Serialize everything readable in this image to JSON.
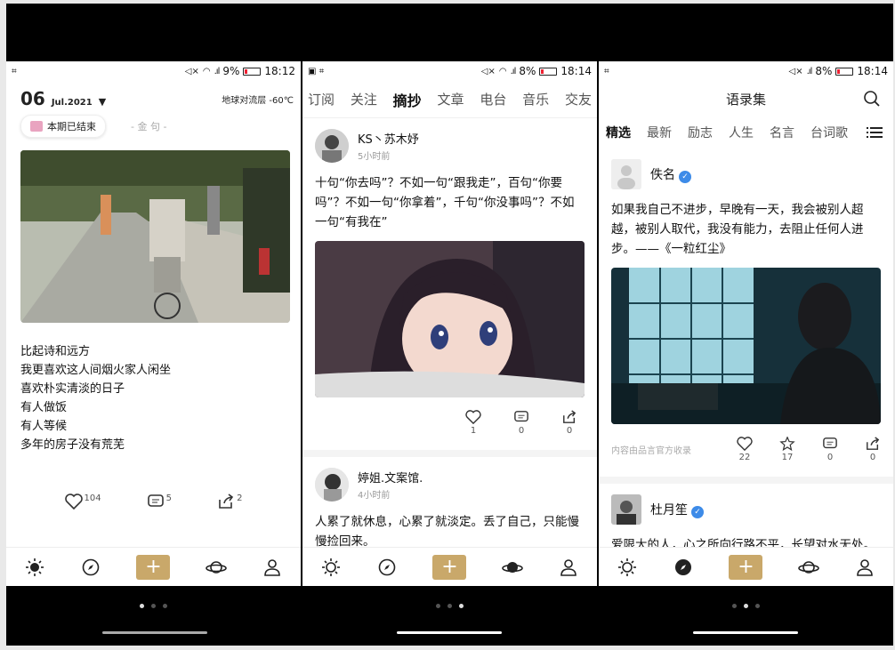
{
  "screens": {
    "p1": {
      "status": {
        "left": "🕗",
        "batt": "9%",
        "time": "18:12"
      },
      "date": {
        "day": "06",
        "month": "Jul.2021"
      },
      "weather": "地球对流层 -60℃",
      "tag": "本期已结束",
      "category": "- 金 句 -",
      "poem": [
        "比起诗和远方",
        "我更喜欢这人间烟火家人闲坐",
        "喜欢朴实清淡的日子",
        "有人做饭",
        "有人等候",
        "多年的房子没有荒芜"
      ],
      "likes": "104",
      "comments": "5",
      "shares": "2"
    },
    "p2": {
      "status": {
        "batt": "8%",
        "time": "18:14"
      },
      "tabs": [
        "订阅",
        "关注",
        "摘抄",
        "文章",
        "电台",
        "音乐",
        "交友"
      ],
      "post1": {
        "name": "KS丶苏木妤",
        "time": "5小时前",
        "text": "十句“你去吗”？不如一句“跟我走”，百句“你要吗”？不如一句“你拿着”，千句“你没事吗”？不如一句“有我在”",
        "likes": "1",
        "comments": "0",
        "shares": "0"
      },
      "post2": {
        "name": "婷姐.文案馆.",
        "time": "4小时前",
        "text": "人累了就休息，心累了就淡定。丢了自己，只能慢慢捡回来。"
      }
    },
    "p3": {
      "status": {
        "batt": "8%",
        "time": "18:14"
      },
      "title": "语录集",
      "tabs": [
        "精选",
        "最新",
        "励志",
        "人生",
        "名言",
        "台词歌"
      ],
      "card1": {
        "name": "佚名",
        "text": "如果我自己不进步，早晚有一天，我会被别人超越，被别人取代，我没有能力，去阻止任何人进步。——《一粒红尘》",
        "source": "内容由品言官方收录",
        "likes": "22",
        "stars": "17",
        "comments": "0",
        "shares": "0"
      },
      "card2": {
        "name": "杜月笙",
        "text": "爱限大的人，心之所向行路不平，长望对水无处。"
      }
    }
  },
  "colors": {
    "accent": "#c9a86a",
    "verified": "#3d8be8"
  }
}
